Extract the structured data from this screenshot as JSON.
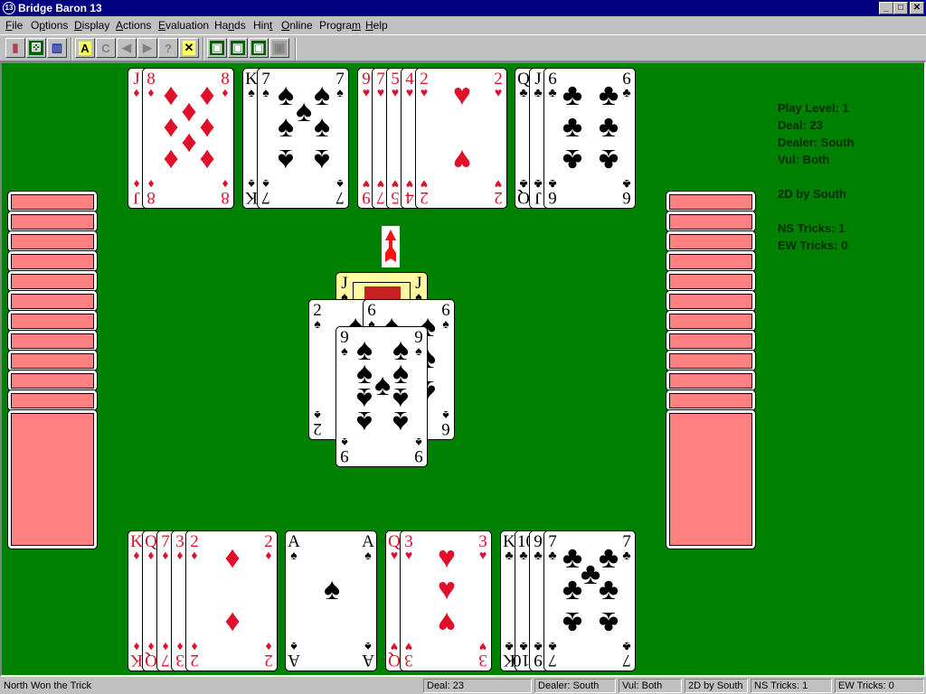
{
  "window": {
    "title": "Bridge Baron 13",
    "controls": {
      "minimize": "_",
      "maximize": "□",
      "close": "✕"
    }
  },
  "menu": [
    {
      "label": "File",
      "key": "F"
    },
    {
      "label": "Options",
      "key": "p"
    },
    {
      "label": "Display",
      "key": "D"
    },
    {
      "label": "Actions",
      "key": "A"
    },
    {
      "label": "Evaluation",
      "key": "E"
    },
    {
      "label": "Hands",
      "key": "n"
    },
    {
      "label": "Hint",
      "key": "t"
    },
    {
      "label": "Online",
      "key": "O"
    },
    {
      "label": "Program",
      "key": "m"
    },
    {
      "label": "Help",
      "key": "H"
    }
  ],
  "toolbar": [
    {
      "name": "card-back-icon",
      "glyph": "▮",
      "enabled": true
    },
    {
      "name": "dice-icon",
      "glyph": "⚄",
      "enabled": true
    },
    {
      "name": "hands-view-icon",
      "glyph": "▥",
      "enabled": true
    },
    {
      "name": "auto-play-icon",
      "glyph": "A",
      "enabled": true
    },
    {
      "name": "claim-icon",
      "glyph": "C",
      "enabled": false
    },
    {
      "name": "back-icon",
      "glyph": "◀",
      "enabled": false
    },
    {
      "name": "forward-icon",
      "glyph": "▶",
      "enabled": false
    },
    {
      "name": "hint-icon",
      "glyph": "?",
      "enabled": false
    },
    {
      "name": "undo-icon",
      "glyph": "✕",
      "enabled": true
    },
    {
      "name": "view-1-icon",
      "glyph": "▣",
      "enabled": true
    },
    {
      "name": "view-2-icon",
      "glyph": "▣",
      "enabled": true
    },
    {
      "name": "view-3-icon",
      "glyph": "▣",
      "enabled": true
    },
    {
      "name": "view-4-icon",
      "glyph": "▣",
      "enabled": false
    }
  ],
  "colors": {
    "table": "#008000",
    "card_back": "#ff8080",
    "red_suit": "#e0102a",
    "title_bar": "#000080"
  },
  "info": {
    "play_level": "Play Level: 1",
    "deal": "Deal: 23",
    "dealer": "Dealer: South",
    "vul": "Vul: Both",
    "contract": "2D by South",
    "ns_tricks": "NS Tricks: 1",
    "ew_tricks": "EW Tricks: 0"
  },
  "hands": {
    "north": [
      {
        "suit": "♦",
        "color": "red",
        "ranks": [
          "J",
          "8"
        ]
      },
      {
        "suit": "♠",
        "color": "black",
        "ranks": [
          "K",
          "7"
        ]
      },
      {
        "suit": "♥",
        "color": "red",
        "ranks": [
          "9",
          "7",
          "5",
          "4",
          "2"
        ]
      },
      {
        "suit": "♣",
        "color": "black",
        "ranks": [
          "Q",
          "J",
          "6"
        ]
      }
    ],
    "south": [
      {
        "suit": "♦",
        "color": "red",
        "ranks": [
          "K",
          "Q",
          "7",
          "3",
          "2"
        ]
      },
      {
        "suit": "♠",
        "color": "black",
        "ranks": [
          "A"
        ]
      },
      {
        "suit": "♥",
        "color": "red",
        "ranks": [
          "Q",
          "3"
        ]
      },
      {
        "suit": "♣",
        "color": "black",
        "ranks": [
          "K",
          "10",
          "9",
          "7"
        ]
      }
    ],
    "west": {
      "cards_remaining": 12
    },
    "east": {
      "cards_remaining": 12
    }
  },
  "trick": {
    "north": {
      "rank": "J",
      "suit": "♠"
    },
    "west": {
      "rank": "2",
      "suit": "♠"
    },
    "east": {
      "rank": "6",
      "suit": "♠"
    },
    "south": {
      "rank": "9",
      "suit": "♠"
    },
    "lead_indicator": "north"
  },
  "status": {
    "message": "North Won the Trick",
    "deal": "Deal: 23",
    "dealer": "Dealer: South",
    "vul": "Vul: Both",
    "contract": "2D by South",
    "ns_tricks": "NS Tricks: 1",
    "ew_tricks": "EW Tricks: 0"
  }
}
